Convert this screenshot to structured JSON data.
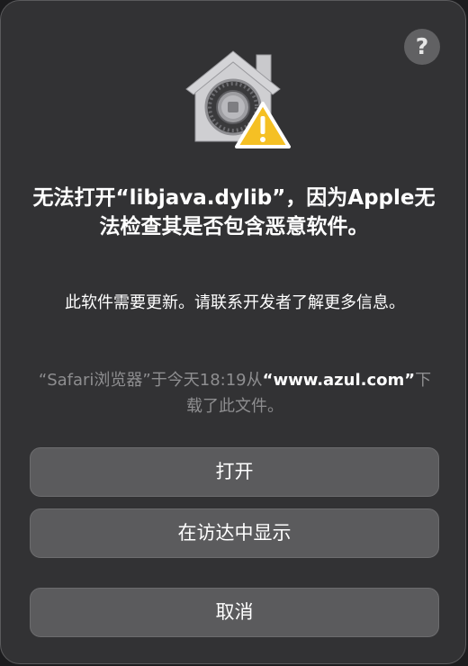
{
  "dialog": {
    "help_label": "?",
    "icon": "gatekeeper-security-icon",
    "title": "无法打开“libjava.dylib”，因为Apple无法检查其是否包含恶意软件。",
    "message": "此软件需要更新。请联系开发者了解更多信息。",
    "source_prefix": "“Safari浏览器”于今天18:19从",
    "source_domain": "“www.azul.com”",
    "source_suffix": "下载了此文件。"
  },
  "buttons": {
    "open_label": "打开",
    "show_in_finder_label": "在访达中显示",
    "cancel_label": "取消"
  },
  "colors": {
    "background": "#323234",
    "button": "#5b5b5d",
    "secondary_text": "#8e8e90",
    "warning": "#f5c024"
  }
}
